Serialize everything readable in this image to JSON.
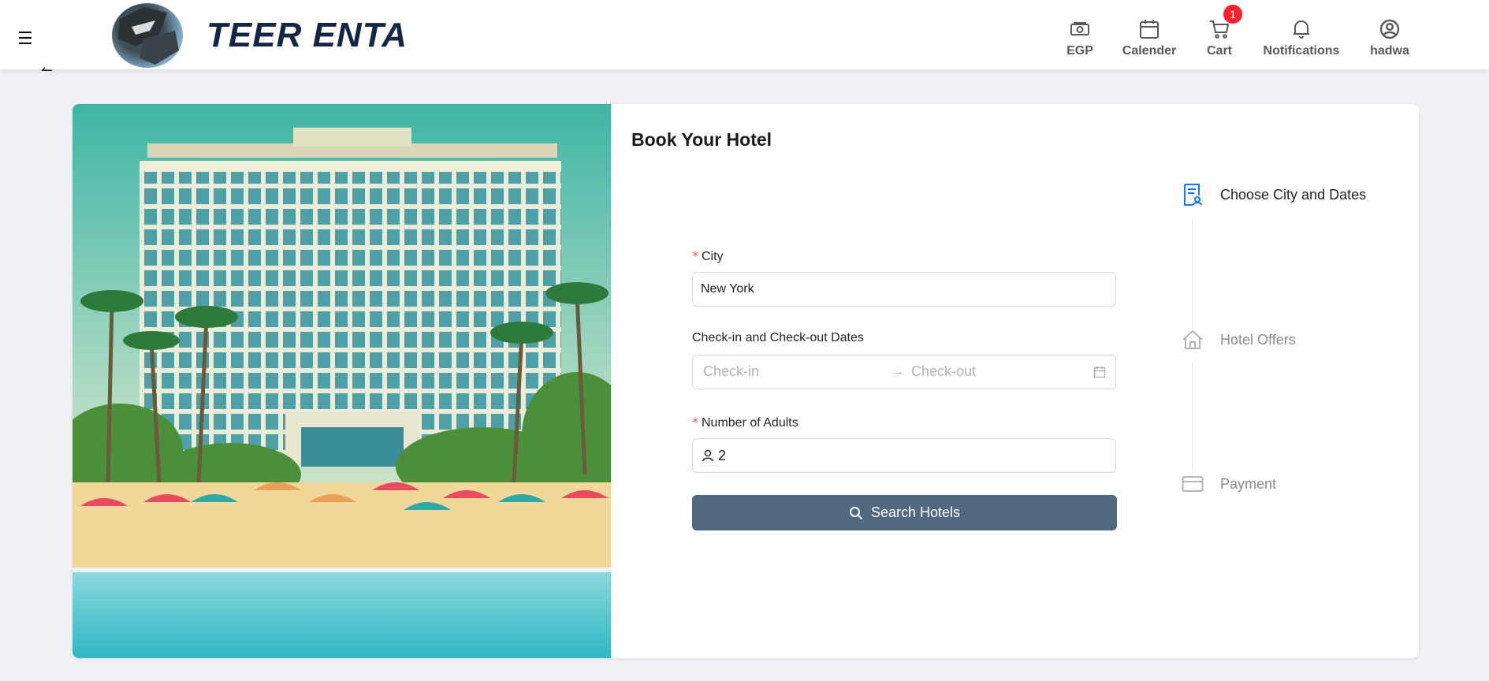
{
  "header": {
    "brand": "TEER ENTA",
    "nav": [
      {
        "label": "EGP",
        "icon": "money-icon"
      },
      {
        "label": "Calender",
        "icon": "calendar-icon"
      },
      {
        "label": "Cart",
        "icon": "cart-icon",
        "badge": "1"
      },
      {
        "label": "Notifications",
        "icon": "bell-icon"
      },
      {
        "label": "hadwa",
        "icon": "user-circle-icon"
      }
    ]
  },
  "form": {
    "title": "Book Your Hotel",
    "city_label": "City",
    "city_value": "New York",
    "dates_label": "Check-in and Check-out Dates",
    "checkin_placeholder": "Check-in",
    "checkout_placeholder": "Check-out",
    "adults_label": "Number of Adults",
    "adults_value": "2",
    "search_button": "Search Hotels"
  },
  "steps": [
    {
      "label": "Choose City and Dates",
      "active": true
    },
    {
      "label": "Hotel Offers",
      "active": false
    },
    {
      "label": "Payment",
      "active": false
    }
  ],
  "colors": {
    "primary_button": "#51697f",
    "active_step": "#1677ff",
    "inactive_step": "#8c8c8c",
    "brand": "#152644",
    "badge": "#ff1f2e"
  }
}
